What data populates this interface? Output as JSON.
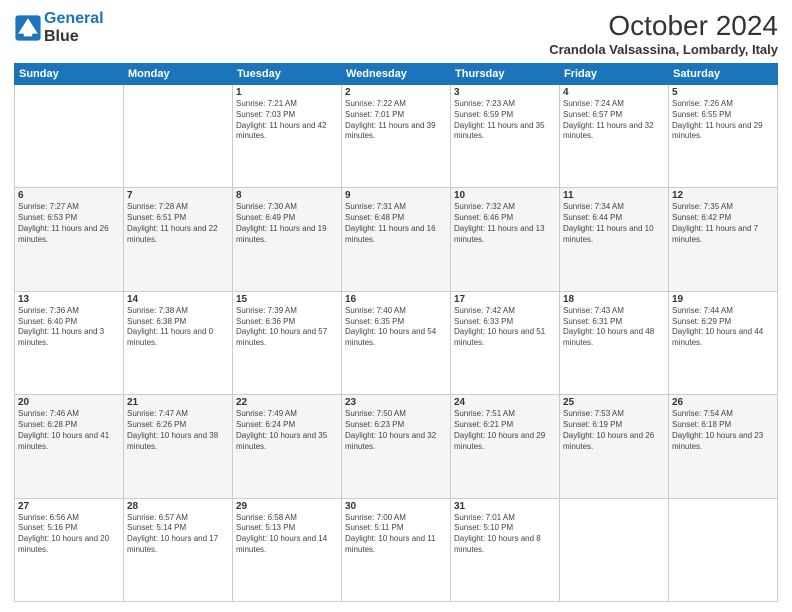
{
  "header": {
    "logo_line1": "General",
    "logo_line2": "Blue",
    "month": "October 2024",
    "location": "Crandola Valsassina, Lombardy, Italy"
  },
  "days_of_week": [
    "Sunday",
    "Monday",
    "Tuesday",
    "Wednesday",
    "Thursday",
    "Friday",
    "Saturday"
  ],
  "weeks": [
    [
      {
        "day": "",
        "sunrise": "",
        "sunset": "",
        "daylight": ""
      },
      {
        "day": "",
        "sunrise": "",
        "sunset": "",
        "daylight": ""
      },
      {
        "day": "1",
        "sunrise": "Sunrise: 7:21 AM",
        "sunset": "Sunset: 7:03 PM",
        "daylight": "Daylight: 11 hours and 42 minutes."
      },
      {
        "day": "2",
        "sunrise": "Sunrise: 7:22 AM",
        "sunset": "Sunset: 7:01 PM",
        "daylight": "Daylight: 11 hours and 39 minutes."
      },
      {
        "day": "3",
        "sunrise": "Sunrise: 7:23 AM",
        "sunset": "Sunset: 6:59 PM",
        "daylight": "Daylight: 11 hours and 35 minutes."
      },
      {
        "day": "4",
        "sunrise": "Sunrise: 7:24 AM",
        "sunset": "Sunset: 6:57 PM",
        "daylight": "Daylight: 11 hours and 32 minutes."
      },
      {
        "day": "5",
        "sunrise": "Sunrise: 7:26 AM",
        "sunset": "Sunset: 6:55 PM",
        "daylight": "Daylight: 11 hours and 29 minutes."
      }
    ],
    [
      {
        "day": "6",
        "sunrise": "Sunrise: 7:27 AM",
        "sunset": "Sunset: 6:53 PM",
        "daylight": "Daylight: 11 hours and 26 minutes."
      },
      {
        "day": "7",
        "sunrise": "Sunrise: 7:28 AM",
        "sunset": "Sunset: 6:51 PM",
        "daylight": "Daylight: 11 hours and 22 minutes."
      },
      {
        "day": "8",
        "sunrise": "Sunrise: 7:30 AM",
        "sunset": "Sunset: 6:49 PM",
        "daylight": "Daylight: 11 hours and 19 minutes."
      },
      {
        "day": "9",
        "sunrise": "Sunrise: 7:31 AM",
        "sunset": "Sunset: 6:48 PM",
        "daylight": "Daylight: 11 hours and 16 minutes."
      },
      {
        "day": "10",
        "sunrise": "Sunrise: 7:32 AM",
        "sunset": "Sunset: 6:46 PM",
        "daylight": "Daylight: 11 hours and 13 minutes."
      },
      {
        "day": "11",
        "sunrise": "Sunrise: 7:34 AM",
        "sunset": "Sunset: 6:44 PM",
        "daylight": "Daylight: 11 hours and 10 minutes."
      },
      {
        "day": "12",
        "sunrise": "Sunrise: 7:35 AM",
        "sunset": "Sunset: 6:42 PM",
        "daylight": "Daylight: 11 hours and 7 minutes."
      }
    ],
    [
      {
        "day": "13",
        "sunrise": "Sunrise: 7:36 AM",
        "sunset": "Sunset: 6:40 PM",
        "daylight": "Daylight: 11 hours and 3 minutes."
      },
      {
        "day": "14",
        "sunrise": "Sunrise: 7:38 AM",
        "sunset": "Sunset: 6:38 PM",
        "daylight": "Daylight: 11 hours and 0 minutes."
      },
      {
        "day": "15",
        "sunrise": "Sunrise: 7:39 AM",
        "sunset": "Sunset: 6:36 PM",
        "daylight": "Daylight: 10 hours and 57 minutes."
      },
      {
        "day": "16",
        "sunrise": "Sunrise: 7:40 AM",
        "sunset": "Sunset: 6:35 PM",
        "daylight": "Daylight: 10 hours and 54 minutes."
      },
      {
        "day": "17",
        "sunrise": "Sunrise: 7:42 AM",
        "sunset": "Sunset: 6:33 PM",
        "daylight": "Daylight: 10 hours and 51 minutes."
      },
      {
        "day": "18",
        "sunrise": "Sunrise: 7:43 AM",
        "sunset": "Sunset: 6:31 PM",
        "daylight": "Daylight: 10 hours and 48 minutes."
      },
      {
        "day": "19",
        "sunrise": "Sunrise: 7:44 AM",
        "sunset": "Sunset: 6:29 PM",
        "daylight": "Daylight: 10 hours and 44 minutes."
      }
    ],
    [
      {
        "day": "20",
        "sunrise": "Sunrise: 7:46 AM",
        "sunset": "Sunset: 6:28 PM",
        "daylight": "Daylight: 10 hours and 41 minutes."
      },
      {
        "day": "21",
        "sunrise": "Sunrise: 7:47 AM",
        "sunset": "Sunset: 6:26 PM",
        "daylight": "Daylight: 10 hours and 38 minutes."
      },
      {
        "day": "22",
        "sunrise": "Sunrise: 7:49 AM",
        "sunset": "Sunset: 6:24 PM",
        "daylight": "Daylight: 10 hours and 35 minutes."
      },
      {
        "day": "23",
        "sunrise": "Sunrise: 7:50 AM",
        "sunset": "Sunset: 6:23 PM",
        "daylight": "Daylight: 10 hours and 32 minutes."
      },
      {
        "day": "24",
        "sunrise": "Sunrise: 7:51 AM",
        "sunset": "Sunset: 6:21 PM",
        "daylight": "Daylight: 10 hours and 29 minutes."
      },
      {
        "day": "25",
        "sunrise": "Sunrise: 7:53 AM",
        "sunset": "Sunset: 6:19 PM",
        "daylight": "Daylight: 10 hours and 26 minutes."
      },
      {
        "day": "26",
        "sunrise": "Sunrise: 7:54 AM",
        "sunset": "Sunset: 6:18 PM",
        "daylight": "Daylight: 10 hours and 23 minutes."
      }
    ],
    [
      {
        "day": "27",
        "sunrise": "Sunrise: 6:56 AM",
        "sunset": "Sunset: 5:16 PM",
        "daylight": "Daylight: 10 hours and 20 minutes."
      },
      {
        "day": "28",
        "sunrise": "Sunrise: 6:57 AM",
        "sunset": "Sunset: 5:14 PM",
        "daylight": "Daylight: 10 hours and 17 minutes."
      },
      {
        "day": "29",
        "sunrise": "Sunrise: 6:58 AM",
        "sunset": "Sunset: 5:13 PM",
        "daylight": "Daylight: 10 hours and 14 minutes."
      },
      {
        "day": "30",
        "sunrise": "Sunrise: 7:00 AM",
        "sunset": "Sunset: 5:11 PM",
        "daylight": "Daylight: 10 hours and 11 minutes."
      },
      {
        "day": "31",
        "sunrise": "Sunrise: 7:01 AM",
        "sunset": "Sunset: 5:10 PM",
        "daylight": "Daylight: 10 hours and 8 minutes."
      },
      {
        "day": "",
        "sunrise": "",
        "sunset": "",
        "daylight": ""
      },
      {
        "day": "",
        "sunrise": "",
        "sunset": "",
        "daylight": ""
      }
    ]
  ]
}
